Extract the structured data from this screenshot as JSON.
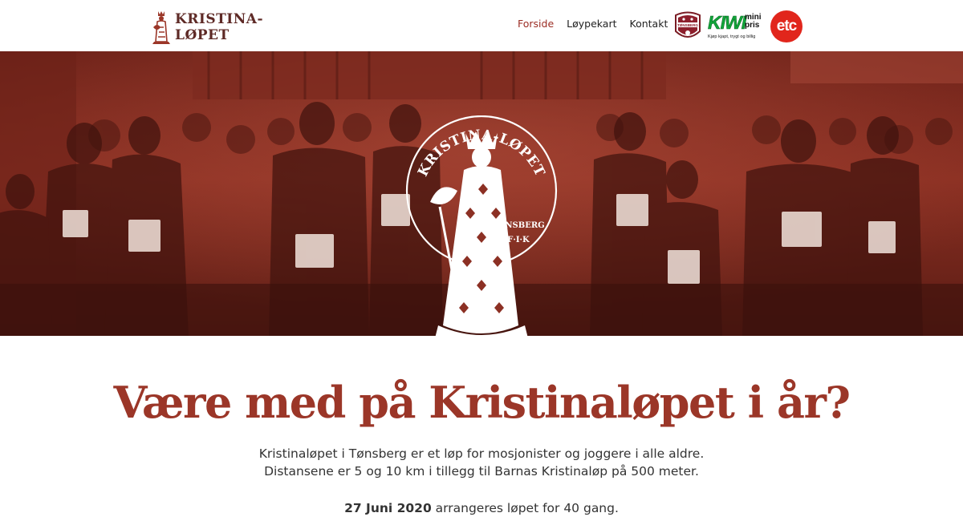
{
  "header": {
    "brand": {
      "line1": "KRISTINA-",
      "line2": "LØPET",
      "icon": "queen-emblem-icon"
    },
    "nav": [
      {
        "label": "Forside",
        "active": true
      },
      {
        "label": "Løypekart",
        "active": false
      },
      {
        "label": "Kontakt",
        "active": false
      }
    ],
    "sponsors": {
      "tfik": {
        "icon": "tonsberg-fik-badge-icon",
        "text": "TØNSBERG"
      },
      "kiwi": {
        "name": "KIWI",
        "mini": "mini",
        "pris": "pris",
        "tagline": "Kjøp kjapt, trygt og billig"
      },
      "etc": {
        "name": "etc"
      }
    }
  },
  "hero": {
    "background": "runners-start-photo",
    "emblem": {
      "title": "KRISTINA-LØPET",
      "side_top": "TØNSBERG",
      "side_bottom": "F·I·K"
    }
  },
  "main": {
    "headline": "Være med på Kristinaløpet i år?",
    "intro_line1": "Kristinaløpet i Tønsberg er et løp for mosjonister og joggere i alle aldre.",
    "intro_line2": "Distansene er 5 og 10 km i tillegg til Barnas Kristinaløp på 500 meter.",
    "date": "27 Juni 2020",
    "date_rest": " arrangeres løpet for 40 gang."
  },
  "colors": {
    "accent": "#9b3628",
    "brand_dark": "#5e2a26",
    "hero_tint": "#8c3024",
    "kiwi_green": "#11a63a",
    "etc_red": "#e1261c"
  }
}
